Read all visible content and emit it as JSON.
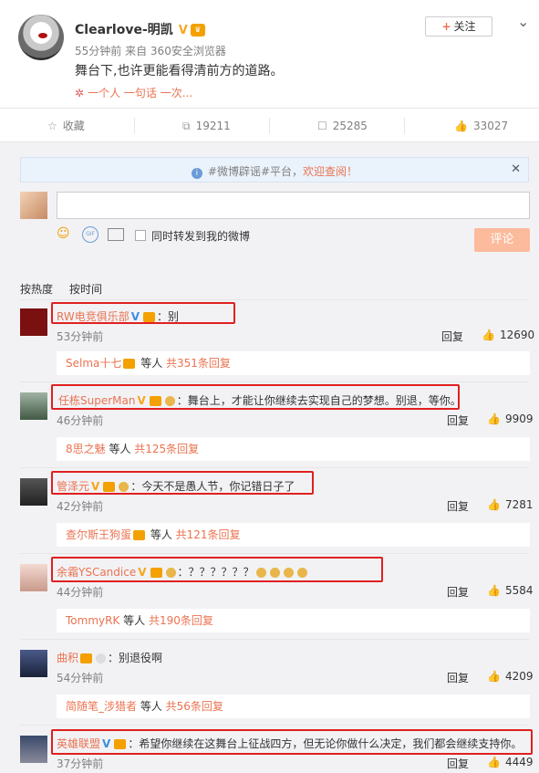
{
  "post": {
    "author": "Clearlove-明凯",
    "verified": "V",
    "time": "55分钟前",
    "source": "来自 360安全浏览器",
    "text": "舞台下,也许更能看得清前方的道路。",
    "topic": "一个人 一句话 一次...",
    "follow_label": "关注"
  },
  "actions": {
    "collect": "收藏",
    "repost": "19211",
    "comment": "25285",
    "like": "33027"
  },
  "notice": {
    "text": "#微博辟谣#平台，",
    "link": "欢迎查阅！"
  },
  "composer": {
    "repost_label": "同时转发到我的微博",
    "submit_label": "评论"
  },
  "sort": {
    "hot": "按热度",
    "time": "按时间"
  },
  "comments": [
    {
      "name": "RW电竞俱乐部",
      "text": "：别",
      "time": "53分钟前",
      "reply": "回复",
      "likes": "12690",
      "sub_name": "Selma十七",
      "sub_mid": " 等人 ",
      "sub_count": "共351条回复"
    },
    {
      "name": "任栋SuperMan",
      "text": "：舞台上，才能让你继续去实现自己的梦想。别退，等你。",
      "time": "46分钟前",
      "reply": "回复",
      "likes": "9909",
      "sub_name": "8思之魅",
      "sub_mid": " 等人 ",
      "sub_count": "共125条回复"
    },
    {
      "name": "管泽元",
      "text": "：今天不是愚人节，你记错日子了",
      "time": "42分钟前",
      "reply": "回复",
      "likes": "7281",
      "sub_name": "查尔斯王狗蛋",
      "sub_mid": " 等人 ",
      "sub_count": "共121条回复"
    },
    {
      "name": "余霜YSCandice",
      "text": "：？？？？？？",
      "time": "44分钟前",
      "reply": "回复",
      "likes": "5584",
      "sub_name": "TommyRK",
      "sub_mid": " 等人 ",
      "sub_count": "共190条回复"
    },
    {
      "name": "曲积",
      "text": "：别退役啊",
      "time": "54分钟前",
      "reply": "回复",
      "likes": "4209",
      "sub_name": "简随笔_涉猎者",
      "sub_mid": " 等人 ",
      "sub_count": "共56条回复"
    },
    {
      "name": "英雄联盟",
      "text": "：希望你继续在这舞台上征战四方，但无论你做什么决定，我们都会继续支持你。",
      "time": "37分钟前",
      "reply": "回复",
      "likes": "4449"
    }
  ]
}
